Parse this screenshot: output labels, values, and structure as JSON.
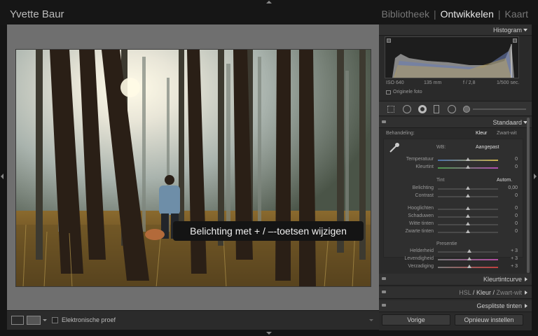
{
  "header": {
    "user": "Yvette Baur",
    "modules": [
      "Bibliotheek",
      "Ontwikkelen",
      "Kaart"
    ],
    "separator": "|",
    "active_module": "Ontwikkelen"
  },
  "tooltip": "Belichting met + / –-toetsen wijzigen",
  "bottombar": {
    "soft_proof": "Elektronische proef"
  },
  "histogram": {
    "title": "Histogram",
    "iso": "ISO 640",
    "focal": "135 mm",
    "aperture": "f / 2,8",
    "shutter": "1/500 sec.",
    "original_photo": "Originele foto"
  },
  "basic": {
    "title": "Standaard",
    "treatment_label": "Behandeling:",
    "treatment_color": "Kleur",
    "treatment_bw": "Zwart-wit",
    "wb_label": "WB:",
    "wb_value": "Aangepast",
    "sliders_wb": [
      {
        "label": "Temperatuur",
        "value": "0",
        "pos": 0.5
      },
      {
        "label": "Kleurtint",
        "value": "0",
        "pos": 0.5
      }
    ],
    "tone_label": "Tint",
    "auto_label": "Autom.",
    "sliders_tone": [
      {
        "label": "Belichting",
        "value": "0,00",
        "pos": 0.5
      },
      {
        "label": "Contrast",
        "value": "0",
        "pos": 0.5
      }
    ],
    "sliders_tone2": [
      {
        "label": "Hooglichten",
        "value": "0",
        "pos": 0.5
      },
      {
        "label": "Schaduwen",
        "value": "0",
        "pos": 0.5
      },
      {
        "label": "Witte tinten",
        "value": "0",
        "pos": 0.5
      },
      {
        "label": "Zwarte tinten",
        "value": "0",
        "pos": 0.5
      }
    ],
    "presence_label": "Presentie",
    "sliders_presence": [
      {
        "label": "Helderheid",
        "value": "+ 3",
        "pos": 0.52
      },
      {
        "label": "Levendigheid",
        "value": "+ 3",
        "pos": 0.52
      },
      {
        "label": "Verzadiging",
        "value": "+ 3",
        "pos": 0.52
      }
    ]
  },
  "panels": {
    "tone_curve": "Kleurtintcurve",
    "hsl": "HSL",
    "hsl_color": "Kleur",
    "hsl_bw": "Zwart-wit",
    "hsl_sep": "/",
    "split": "Gesplitste tinten"
  },
  "footer": {
    "previous": "Vorige",
    "reset": "Opnieuw instellen"
  },
  "colors": {
    "active": "#e8e8e8",
    "panel": "#2a2a2a",
    "canvas": "#6f6f6f"
  }
}
